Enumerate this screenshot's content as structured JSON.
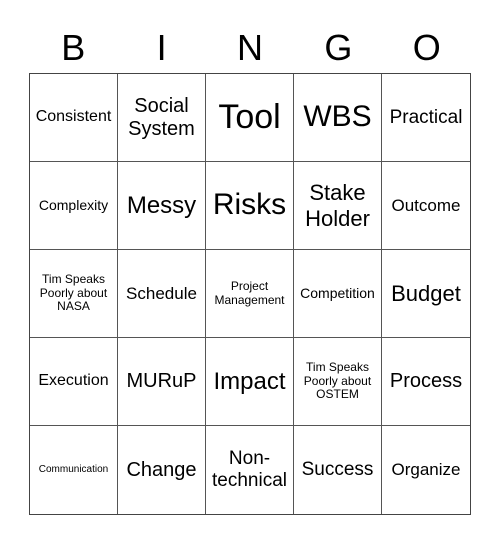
{
  "header": {
    "letters": [
      "B",
      "I",
      "N",
      "G",
      "O"
    ]
  },
  "cells": [
    "Consistent",
    "Social System",
    "Tool",
    "WBS",
    "Practical",
    "Complexity",
    "Messy",
    "Risks",
    "Stake Holder",
    "Outcome",
    "Tim Speaks Poorly about NASA",
    "Schedule",
    "Project Management",
    "Competition",
    "Budget",
    "Execution",
    "MURuP",
    "Impact",
    "Tim Speaks Poorly about OSTEM",
    "Process",
    "Communication",
    "Change",
    "Non-technical",
    "Success",
    "Organize"
  ]
}
